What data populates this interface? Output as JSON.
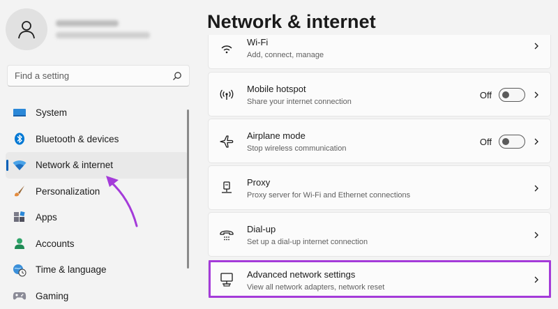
{
  "profile": {
    "name": "Ishan Dasgupta",
    "email": "ishan.dasgupta@outlook.com"
  },
  "search": {
    "placeholder": "Find a setting"
  },
  "sidebar": {
    "items": [
      {
        "label": "System",
        "icon": "monitor-icon"
      },
      {
        "label": "Bluetooth & devices",
        "icon": "bluetooth-icon"
      },
      {
        "label": "Network & internet",
        "icon": "wifi-icon",
        "active": true
      },
      {
        "label": "Personalization",
        "icon": "brush-icon"
      },
      {
        "label": "Apps",
        "icon": "apps-icon"
      },
      {
        "label": "Accounts",
        "icon": "person-icon"
      },
      {
        "label": "Time & language",
        "icon": "globe-clock-icon"
      },
      {
        "label": "Gaming",
        "icon": "gamepad-icon"
      }
    ]
  },
  "main": {
    "title": "Network & internet",
    "wifi": {
      "title": "Wi-Fi",
      "desc": "Add, connect, manage"
    },
    "hotspot": {
      "title": "Mobile hotspot",
      "desc": "Share your internet connection",
      "state": "Off"
    },
    "airplane": {
      "title": "Airplane mode",
      "desc": "Stop wireless communication",
      "state": "Off"
    },
    "proxy": {
      "title": "Proxy",
      "desc": "Proxy server for Wi-Fi and Ethernet connections"
    },
    "dialup": {
      "title": "Dial-up",
      "desc": "Set up a dial-up internet connection"
    },
    "advanced": {
      "title": "Advanced network settings",
      "desc": "View all network adapters, network reset"
    }
  },
  "colors": {
    "accent": "#005fb8",
    "highlight": "#a43bd9",
    "background": "#f3f3f3",
    "card": "#fbfbfb"
  }
}
